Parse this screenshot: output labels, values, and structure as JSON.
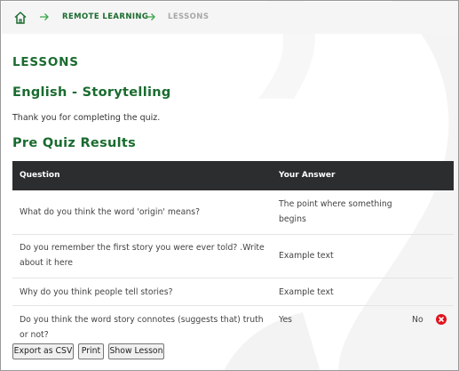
{
  "breadcrumb": {
    "home_icon": "home-icon",
    "separator_icon": "arrow-right-icon",
    "items": [
      "REMOTE LEARNING",
      "LESSONS"
    ]
  },
  "page": {
    "section_title": "LESSONS",
    "lesson_title": "English - Storytelling",
    "message": "Thank you for completing the quiz.",
    "results_title": "Pre Quiz Results"
  },
  "table": {
    "headers": [
      "Question",
      "Your Answer"
    ],
    "rows": [
      {
        "question": "What do you think the word 'origin' means?",
        "answer": "The point where something begins",
        "extra": ""
      },
      {
        "question": "Do you remember the first story you were ever told? .Write about it here",
        "answer": "Example text",
        "extra": ""
      },
      {
        "question": "Why do you think people tell stories?",
        "answer": "Example text",
        "extra": ""
      },
      {
        "question": "Do you think the word story connotes (suggests that) truth or not?",
        "answer": "Yes",
        "extra": "No",
        "status_icon": "error-icon"
      }
    ]
  },
  "buttons": {
    "export": "Export as CSV",
    "print": "Print",
    "show": "Show Lesson"
  },
  "colors": {
    "accent": "#1a6b2f",
    "header_bg": "#2b2d2f",
    "error": "#e0131d"
  }
}
